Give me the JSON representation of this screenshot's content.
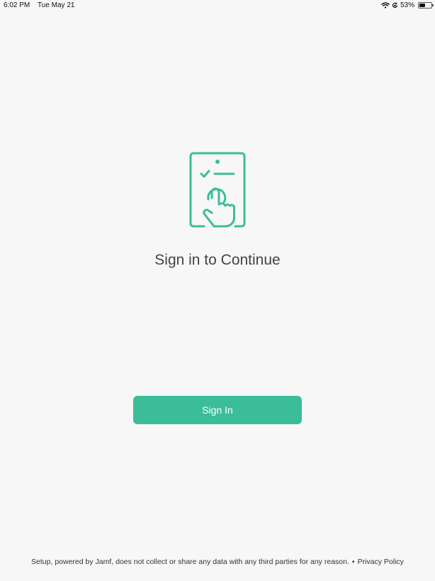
{
  "status_bar": {
    "time": "6:02 PM",
    "date": "Tue May 21",
    "battery_text": "53%",
    "battery_level": 0.53,
    "icons": [
      "wifi-icon",
      "orientation-lock-icon",
      "battery-icon"
    ]
  },
  "main": {
    "title": "Sign in to Continue",
    "illustration": "tap-to-sign-in-icon"
  },
  "actions": {
    "sign_in_label": "Sign In",
    "accent_color": "#3bbd99"
  },
  "footer": {
    "disclaimer": "Setup, powered by Jamf, does not collect or share any data with any third parties for any reason.",
    "separator": "•",
    "privacy_link": "Privacy Policy"
  }
}
